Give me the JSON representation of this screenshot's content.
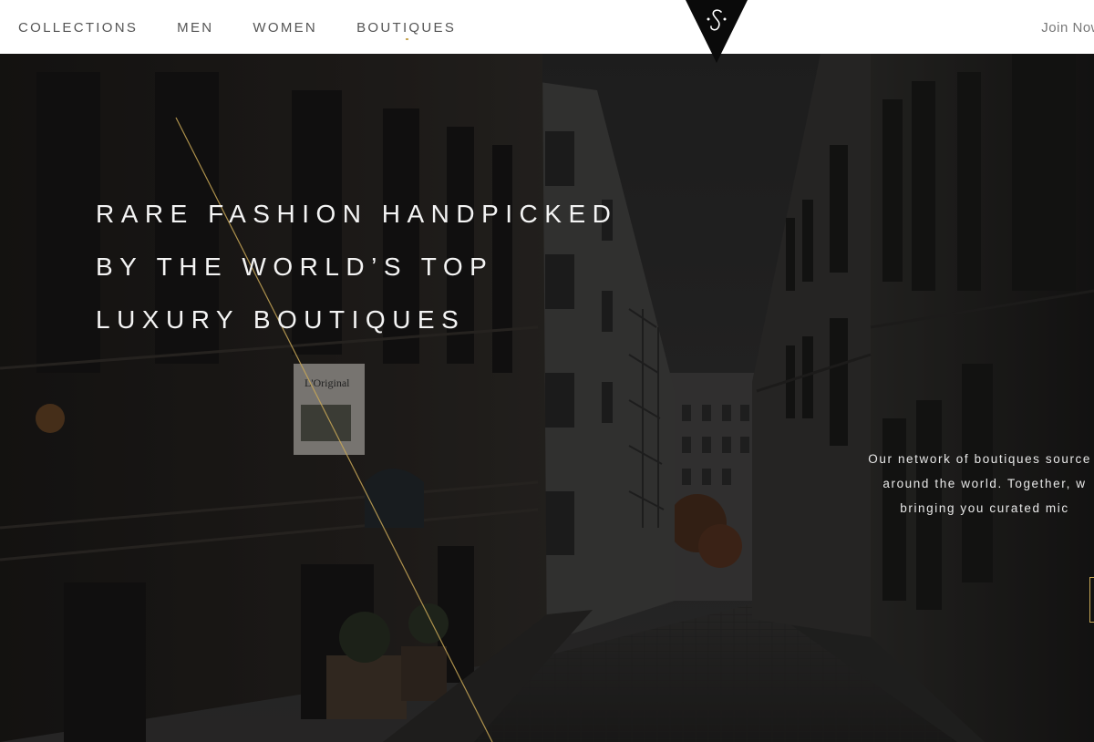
{
  "header": {
    "nav": [
      {
        "label": "COLLECTIONS"
      },
      {
        "label": "MEN"
      },
      {
        "label": "WOMEN"
      },
      {
        "label": "BOUTIQUES"
      }
    ],
    "join_label": "Join Now",
    "logo_icon": "s-monogram-logo-icon"
  },
  "hero": {
    "title_lines": [
      "RARE FASHION HANDPICKED",
      "BY THE WORLD’S TOP",
      "LUXURY BOUTIQUES"
    ],
    "description_lines": [
      "Our network of boutiques source t",
      "around the world. Together, w",
      "bringing you curated mic"
    ],
    "sign_text": "L'Original",
    "background": "dark-city-street-photo"
  },
  "colors": {
    "accent_gold": "#c9a857",
    "header_bg": "#ffffff",
    "nav_text": "#555555",
    "hero_text": "#f4f4f4"
  }
}
